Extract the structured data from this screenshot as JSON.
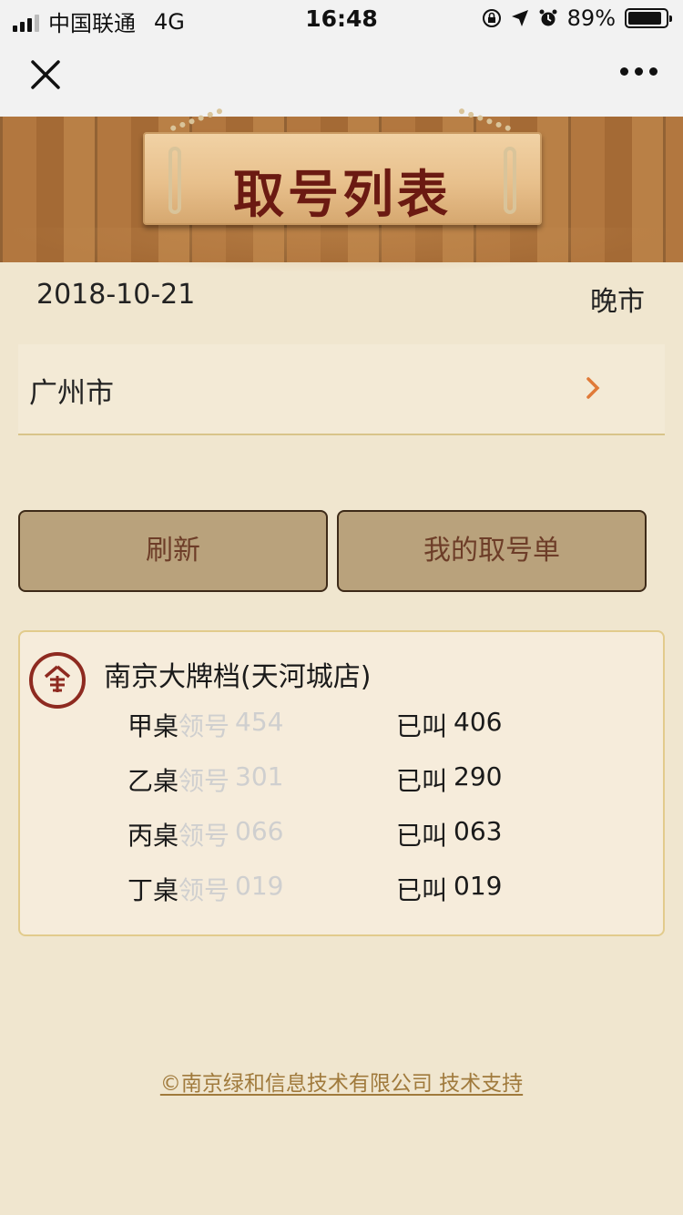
{
  "status_bar": {
    "carrier": "中国联通",
    "network": "4G",
    "time": "16:48",
    "battery": "89%",
    "battery_level": 0.89
  },
  "nav": {
    "close_icon": "close-icon",
    "more_icon": "more-dots-icon"
  },
  "header": {
    "title": "取号列表"
  },
  "info": {
    "date": "2018-10-21",
    "session": "晚市"
  },
  "city": {
    "label": "广州市"
  },
  "buttons": {
    "refresh": "刷新",
    "my_tickets": "我的取号单"
  },
  "restaurant": {
    "name": "南京大牌档(天河城店)",
    "tables": [
      {
        "name": "甲桌",
        "take_label": "领号",
        "take_num": "454",
        "called_label": "已叫",
        "called_num": "406"
      },
      {
        "name": "乙桌",
        "take_label": "领号",
        "take_num": "301",
        "called_label": "已叫",
        "called_num": "290"
      },
      {
        "name": "丙桌",
        "take_label": "领号",
        "take_num": "066",
        "called_label": "已叫",
        "called_num": "063"
      },
      {
        "name": "丁桌",
        "take_label": "领号",
        "take_num": "019",
        "called_label": "已叫",
        "called_num": "019"
      }
    ]
  },
  "footer": {
    "text": "©南京绿和信息技术有限公司 技术支持"
  },
  "colors": {
    "title": "#6b1a12",
    "button_bg": "#b9a27c",
    "button_text": "#6d3d28",
    "accent_chevron": "#e07a38",
    "footer": "#a07a3c"
  }
}
